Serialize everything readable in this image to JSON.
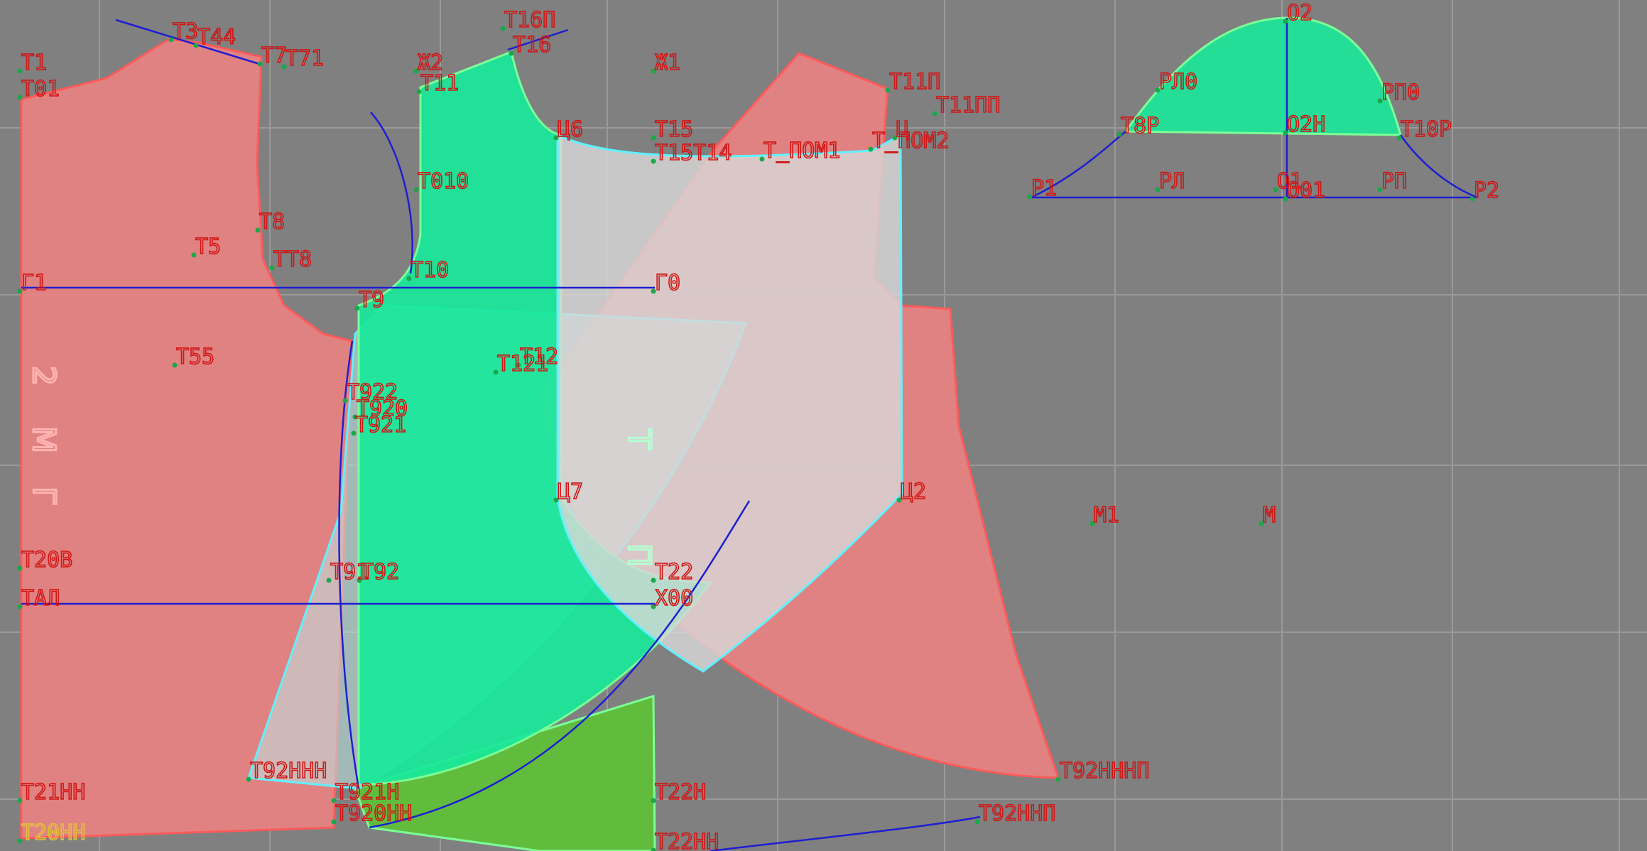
{
  "colors": {
    "background": "#808080",
    "grid": "#9a9a9a",
    "pink_fill": "#e98282",
    "pink_stroke": "#ff5a5a",
    "green_fill": "#19e89a",
    "green_stroke": "#7cff96",
    "white_fill": "#d8d8d8",
    "cyan_stroke": "#5ff2ff",
    "olive_fill": "#5fbf3a",
    "blue_line": "#1e1ed2",
    "label_red": "#d21414",
    "label_yellow": "#e2c23a",
    "point_green": "#1aa84a"
  },
  "labels": [
    "Т1",
    "Т01",
    "Т3",
    "Т44",
    "Т7",
    "Т71",
    "Ж2",
    "Т11",
    "Т16П",
    "Т16",
    "Ж1",
    "Т11П",
    "Т11ПП",
    "Ц6",
    "Т15",
    "Т15Т14",
    "Т_ПОМ1",
    "Т_ПОМ2",
    "Ц",
    "Т010",
    "Т8",
    "Т5",
    "ТТ8",
    "Т10",
    "Г1",
    "Т9",
    "Г0",
    "Т55",
    "Т12",
    "Т121",
    "Т922",
    "Т920",
    "Т921",
    "Ц7",
    "Ц2",
    "М1",
    "М",
    "Т20В",
    "Т91",
    "Т92",
    "Т22",
    "ТАЛ",
    "Х00",
    "Т92ННН",
    "Т92НННП",
    "Т22Н",
    "Т21НН",
    "Т921Н",
    "Т920НН",
    "Т92ННП",
    "Т20НН",
    "Т22НН",
    "О2",
    "РЛ0",
    "РП0",
    "Т8Р",
    "О2Н",
    "Т10Р",
    "Р1",
    "РЛ",
    "О1",
    "О01",
    "РП",
    "Р2"
  ],
  "watermarks": [
    "2",
    "М",
    "Г",
    "Т",
    "П"
  ]
}
